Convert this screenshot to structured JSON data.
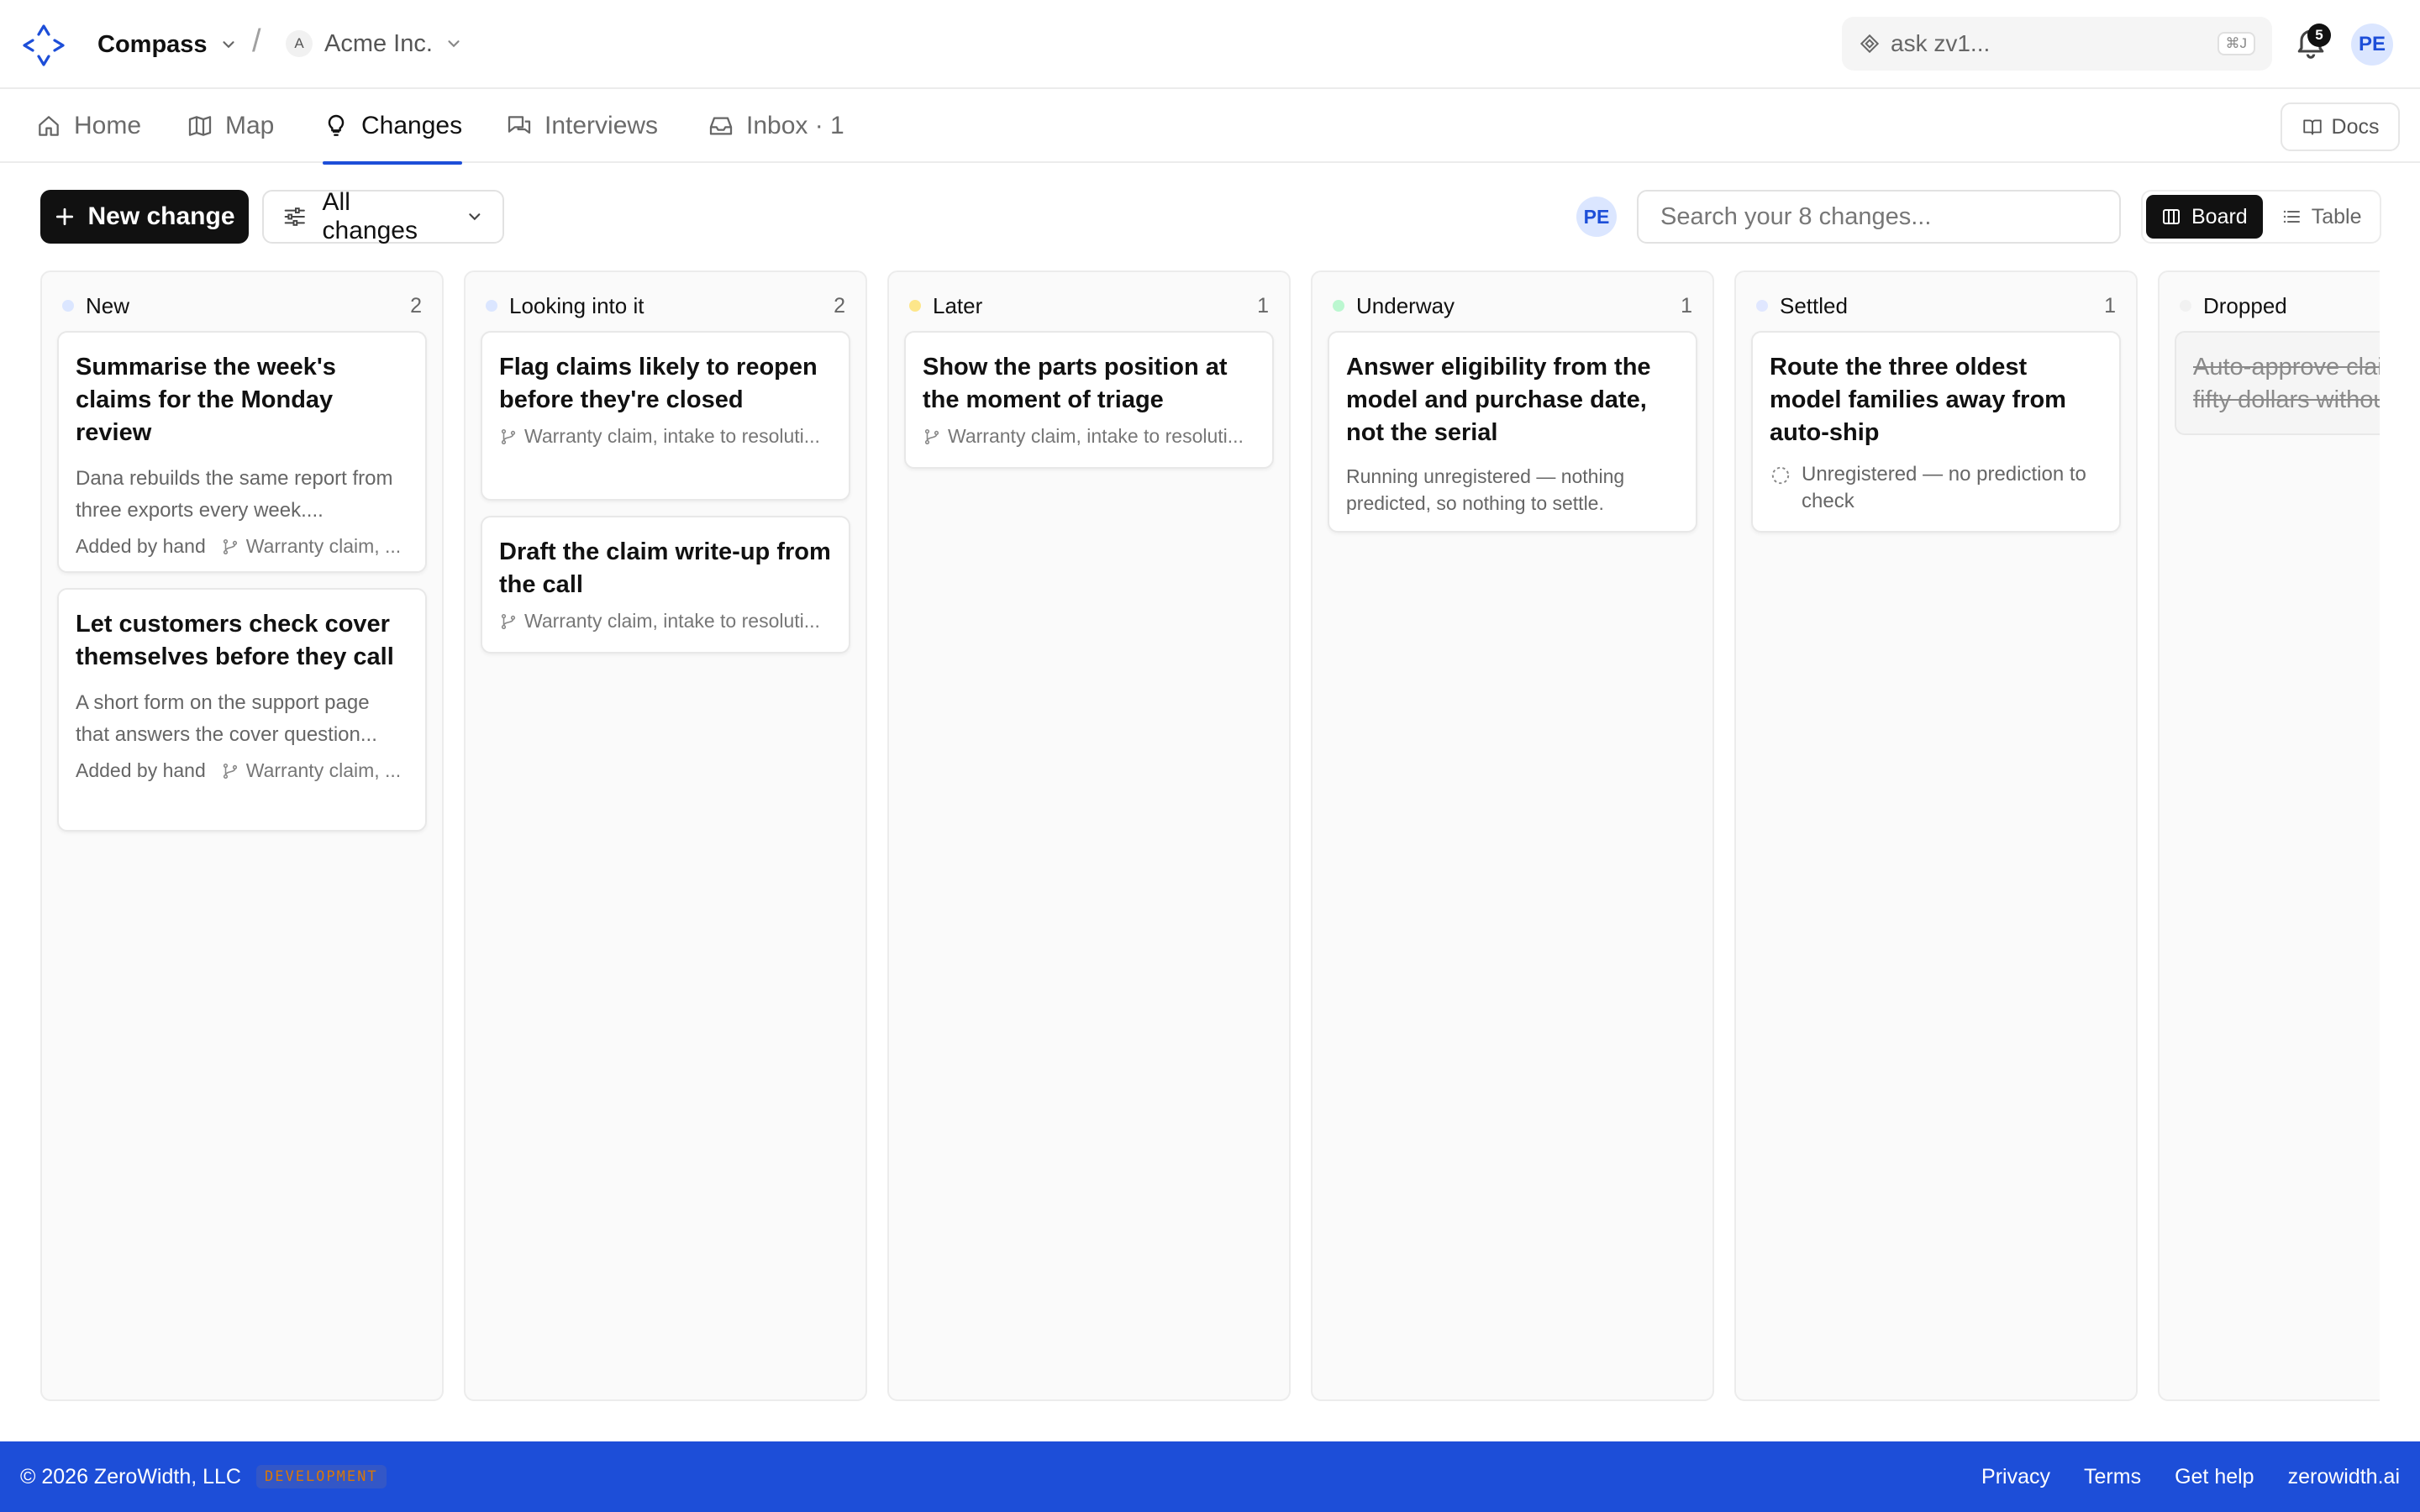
{
  "app": {
    "project_name": "Compass",
    "separator": "/",
    "org_initial": "A",
    "org_name": "Acme Inc.",
    "ask_placeholder": "ask zv1...",
    "ask_shortcut": "⌘J",
    "notifications_count": "5",
    "user_initials": "PE"
  },
  "nav": {
    "items": [
      {
        "label": "Home",
        "icon": "home-icon"
      },
      {
        "label": "Map",
        "icon": "map-icon"
      },
      {
        "label": "Changes",
        "icon": "lightbulb-icon",
        "active": true
      },
      {
        "label": "Interviews",
        "icon": "chat-icon"
      },
      {
        "label": "Inbox · 1",
        "icon": "inbox-icon"
      }
    ],
    "docs_label": "Docs"
  },
  "toolbar": {
    "new_change_label": "New change",
    "filter_label": "All changes",
    "owner_initials": "PE",
    "search_placeholder": "Search your 8 changes...",
    "view_board": "Board",
    "view_table": "Table",
    "active_view": "Board"
  },
  "board": {
    "columns": [
      {
        "name": "New",
        "count": "2",
        "dot_color": "#dbe6ff",
        "cards": [
          {
            "title": "Summarise the week's claims for the Monday review",
            "desc": "Dana rebuilds the same report from three exports every week....",
            "added": "Added by hand",
            "source": "Warranty claim, ..."
          },
          {
            "title": "Let customers check cover themselves before they call",
            "desc": "A short form on the support page that answers the cover question...",
            "added": "Added by hand",
            "source": "Warranty claim, ..."
          }
        ]
      },
      {
        "name": "Looking into it",
        "count": "2",
        "dot_color": "#dbe6ff",
        "cards": [
          {
            "title": "Flag claims likely to reopen before they're closed",
            "source": "Warranty claim, intake to resoluti..."
          },
          {
            "title": "Draft the claim write-up from the call",
            "source": "Warranty claim, intake to resoluti..."
          }
        ]
      },
      {
        "name": "Later",
        "count": "1",
        "dot_color": "#fde68a",
        "cards": [
          {
            "title": "Show the parts position at the moment of triage",
            "source": "Warranty claim, intake to resoluti..."
          }
        ]
      },
      {
        "name": "Underway",
        "count": "1",
        "dot_color": "#bbf7d0",
        "cards": [
          {
            "title": "Answer eligibility from the model and purchase date, not the serial",
            "desc": "Running unregistered — nothing predicted, so nothing to settle."
          }
        ]
      },
      {
        "name": "Settled",
        "count": "1",
        "dot_color": "#e0e7ff",
        "cards": [
          {
            "title": "Route the three oldest model families away from auto-ship",
            "prediction": "Unregistered — no prediction to check"
          }
        ]
      },
      {
        "name": "Dropped",
        "count": "",
        "dot_color": "#f1f1f1",
        "cards": [
          {
            "title": "Auto-approve claims under fifty dollars without review"
          }
        ]
      }
    ]
  },
  "footer": {
    "copyright": "© 2026 ZeroWidth, LLC",
    "env_badge": "DEVELOPMENT",
    "links": [
      "Privacy",
      "Terms",
      "Get help",
      "zerowidth.ai"
    ]
  },
  "colors": {
    "accent": "#1d4ed8",
    "primary_button": "#111111",
    "footer_bg": "#1d4ed8"
  }
}
